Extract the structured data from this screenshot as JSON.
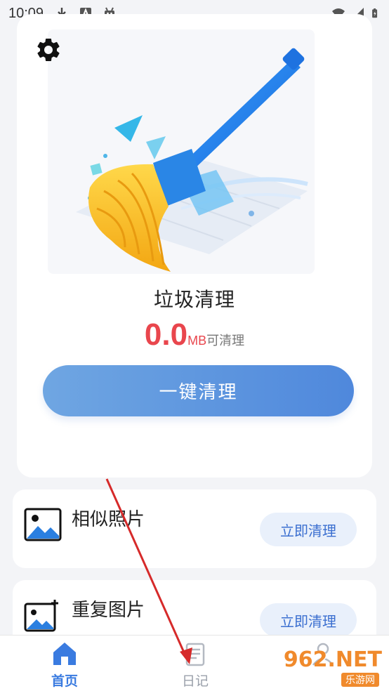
{
  "status_bar": {
    "time": "10:09",
    "icons": [
      "download-icon",
      "a-badge-icon",
      "android-icon",
      "wifi-icon",
      "signal-icon",
      "battery-icon"
    ]
  },
  "cleaner": {
    "title": "垃圾清理",
    "size_value": "0.0",
    "size_unit": "MB",
    "size_suffix": "可清理",
    "button_label": "一键清理"
  },
  "features": [
    {
      "label": "相似照片",
      "action_label": "立即清理",
      "icon": "image-icon"
    },
    {
      "label": "重复图片",
      "action_label": "立即清理",
      "icon": "add-image-icon"
    }
  ],
  "nav": [
    {
      "label": "首页",
      "icon": "home-icon",
      "active": true
    },
    {
      "label": "日记",
      "icon": "diary-icon",
      "active": false
    },
    {
      "label": "",
      "icon": "user-icon",
      "active": false
    }
  ],
  "watermark": {
    "main": "962.NET",
    "sub": "乐游网"
  },
  "colors": {
    "accent": "#4f88dc",
    "size_red": "#e9464d",
    "action_bg": "#e9f0fb",
    "page_bg": "#f3f4f7"
  }
}
